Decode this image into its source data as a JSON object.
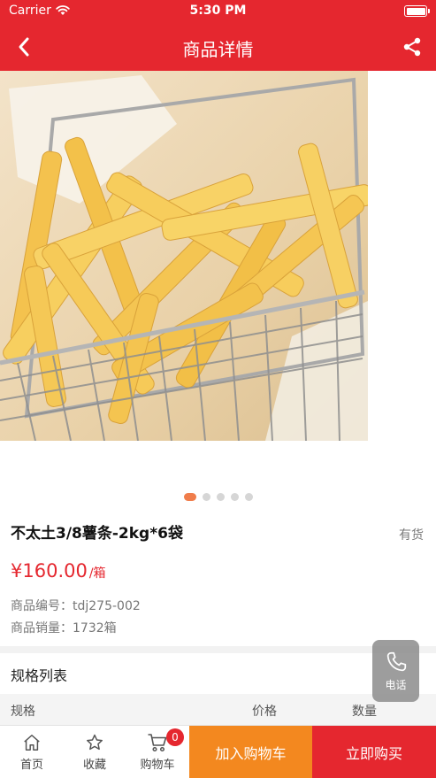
{
  "status_bar": {
    "carrier": "Carrier",
    "time": "5:30 PM"
  },
  "nav": {
    "title": "商品详情",
    "back_icon": "chevron-left-icon",
    "share_icon": "share-icon"
  },
  "gallery": {
    "image": "french-fries-in-wire-basket",
    "slide_count": 5,
    "active_slide": 1
  },
  "product": {
    "name": "不太土3/8薯条-2kg*6袋",
    "stock": "有货",
    "price": "¥160.00",
    "unit": "/箱",
    "code_label": "商品编号：",
    "code": "tdj275-002",
    "sales_label": "商品销量：",
    "sales": "1732箱"
  },
  "specs": {
    "title": "规格列表",
    "columns": [
      "规格",
      "价格",
      "数量"
    ]
  },
  "phone_fab": {
    "label": "电话",
    "icon": "phone-icon"
  },
  "tabbar": {
    "home": "首页",
    "favorite": "收藏",
    "cart": "购物车",
    "cart_badge": "0",
    "add_to_cart": "加入购物车",
    "buy_now": "立即购买"
  },
  "colors": {
    "brand_red": "#e5272f",
    "orange": "#f3881f",
    "active_dot": "#f07d4b"
  }
}
